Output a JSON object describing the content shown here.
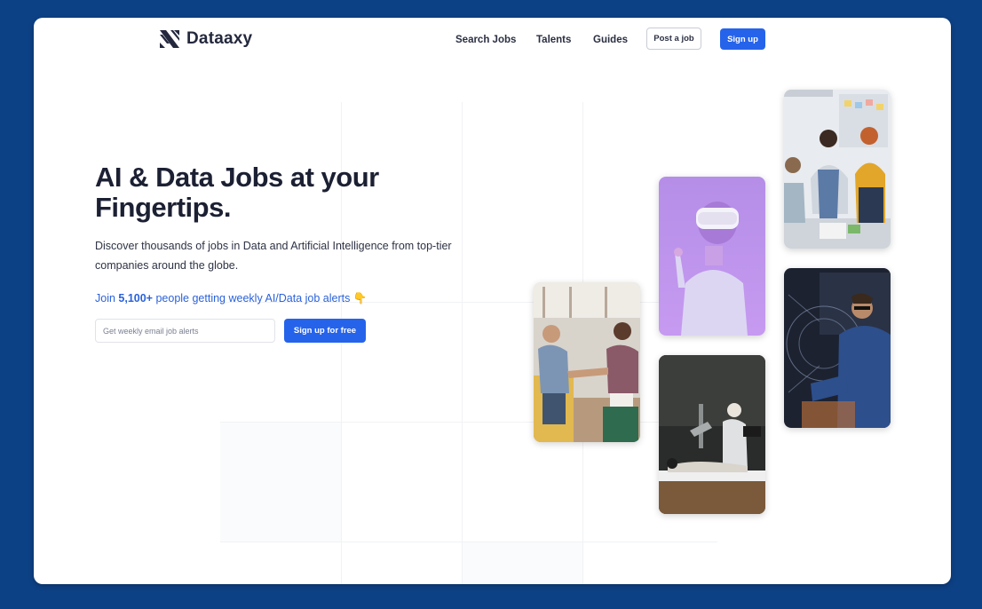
{
  "brand": {
    "name": "Dataaxy",
    "accent": "#2563eb",
    "background": "#0d4185"
  },
  "nav": {
    "items": [
      {
        "label": "Search Jobs"
      },
      {
        "label": "Talents"
      },
      {
        "label": "Guides"
      }
    ],
    "post_job": "Post a job",
    "sign_up": "Sign up"
  },
  "hero": {
    "title": "AI & Data Jobs at your Fingertips.",
    "description": "Discover thousands of jobs in Data and Artificial Intelligence from top-tier companies around the globe.",
    "join_prefix": "Join ",
    "join_count": "5,100+",
    "join_suffix": " people getting weekly AI/Data job alerts 👇",
    "email_placeholder": "Get weekly email job alerts",
    "cta": "Sign up for free"
  },
  "images": [
    {
      "name": "office-team-photo"
    },
    {
      "name": "vr-headset-photo"
    },
    {
      "name": "handshake-meeting-photo"
    },
    {
      "name": "data-analyst-photo"
    },
    {
      "name": "robot-medical-photo"
    }
  ]
}
